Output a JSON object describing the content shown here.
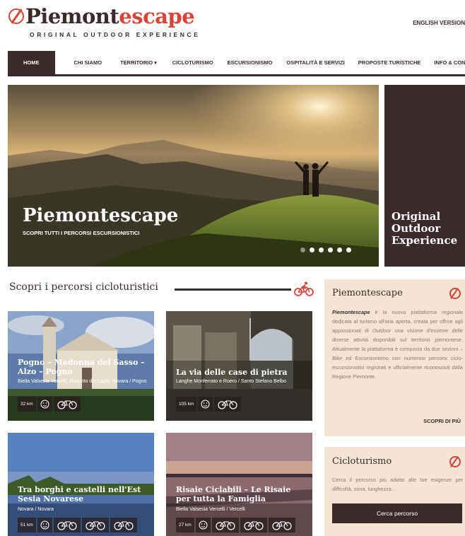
{
  "brand": {
    "name_main": "Piemont",
    "name_accent": "escape",
    "tagline": "ORIGINAL OUTDOOR EXPERIENCE",
    "accent_color": "#d8433a",
    "dark_color": "#3a2a2c"
  },
  "lang_link": "ENGLISH VERSION",
  "nav": {
    "home": "HOME",
    "chi_siamo": "CHI SIAMO",
    "territorio": "TERRITORIO",
    "cicloturismo": "CICLOTURISMO",
    "escursionismo": "ESCURSIONISMO",
    "ospitalita": "OSPITALITÀ E SERVIZI",
    "proposte": "PROPOSTE TURISTICHE",
    "info": "INFO & CONTATTI"
  },
  "hero": {
    "title": "Piemontescape",
    "subtitle": "SCOPRI TUTTI I PERCORSI ESCURSIONISTICI",
    "slide_count": 6,
    "active_slide": 1
  },
  "side_panel": {
    "text": "Original Outdoor Experience"
  },
  "section": {
    "title": "Scopri i percorsi cicloturistici",
    "icon": "cyclist-icon"
  },
  "cards": [
    {
      "title": "Pogno – Madonna del Sasso – Alzo – Pogno",
      "location": "Biella Valsesia Vercelli, Distretto dei Laghi, Novara / Pogno",
      "km": "32 km",
      "bikes": 1
    },
    {
      "title": "La via delle case di pietra",
      "location": "Langhe Monferrato e Roero / Santo Stefano Belbo",
      "km": "105 km",
      "bikes": 1
    },
    {
      "title": "Tra borghi e castelli nell'Est Sesia Novarese",
      "location": "Novara / Novara",
      "km": "51 km",
      "bikes": 3
    },
    {
      "title": "Risaie Ciclabili – Le Risaie per tutta la Famiglia",
      "location": "Biella Valsesia Vercelli / Vercelli",
      "km": "27 km",
      "bikes": 3
    }
  ],
  "info_box": {
    "title": "Piemontescape",
    "text_brand": "Piemontescape",
    "text_1": " è la nuova piattaforma regionale dedicata al turismo all'aria aperta, creata per offrire agli appassionati di ",
    "text_outdoor": "Outdoor",
    "text_2": " una visione d'insieme delle diverse attività disponibili sul territorio piemontese. Attualmente la piattaforma è composta da due sezioni – ",
    "text_bike": "Bike",
    "text_3": " ed Escursionismo con numerosi percorsi ciclo-escursionistici registrati e ufficialmente riconosciuti dalla Regione Piemonte.",
    "link": "SCOPRI DI PIÙ"
  },
  "ciclo_box": {
    "title": "Cicloturismo",
    "text": "Cerca il percorso più adatto alle tue esigenze per difficoltà, zona, lunghezza...",
    "button": "Cerca percorso"
  }
}
